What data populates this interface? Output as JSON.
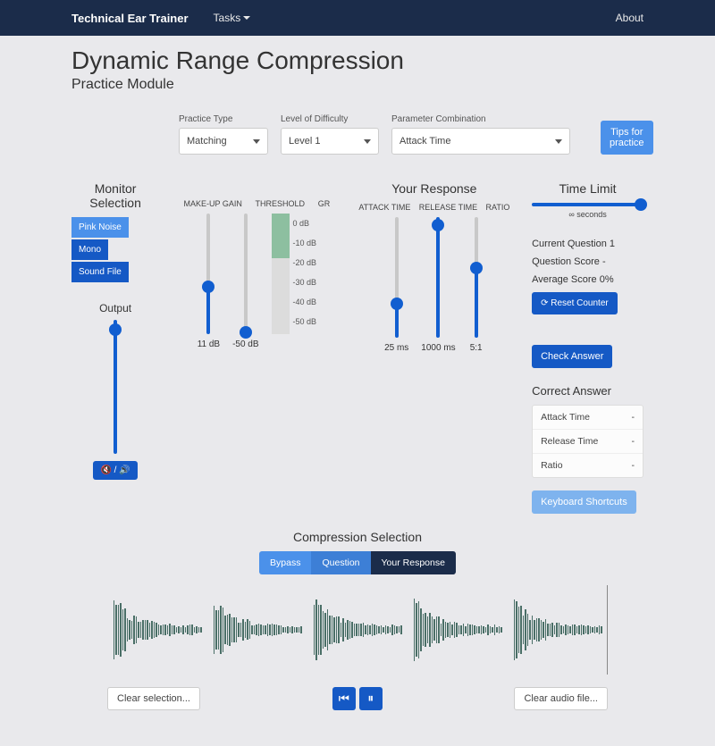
{
  "nav": {
    "brand": "Technical Ear Trainer",
    "tasks": "Tasks",
    "about": "About"
  },
  "title": "Dynamic Range Compression",
  "subtitle": "Practice Module",
  "controls": {
    "practiceType": {
      "label": "Practice Type",
      "value": "Matching"
    },
    "difficulty": {
      "label": "Level of Difficulty",
      "value": "Level 1"
    },
    "paramCombo": {
      "label": "Parameter Combination",
      "value": "Attack Time"
    },
    "tips": "Tips for practice"
  },
  "monitor": {
    "heading": "Monitor Selection",
    "pinkNoise": "Pink Noise",
    "mono": "Mono",
    "soundFile": "Sound File",
    "output": "Output",
    "mute": "🔇 / 🔊"
  },
  "meters": {
    "makeupGain": {
      "label": "MAKE-UP GAIN",
      "value": "11 dB"
    },
    "threshold": {
      "label": "THRESHOLD",
      "value": "-50 dB"
    },
    "gr": {
      "label": "GR",
      "ticks": [
        "0 dB",
        "-10 dB",
        "-20 dB",
        "-30 dB",
        "-40 dB",
        "-50 dB"
      ]
    }
  },
  "response": {
    "heading": "Your Response",
    "attack": {
      "label": "ATTACK TIME",
      "value": "25 ms"
    },
    "release": {
      "label": "RELEASE TIME",
      "value": "1000 ms"
    },
    "ratio": {
      "label": "RATIO",
      "value": "5:1"
    }
  },
  "side": {
    "timeLimit": {
      "heading": "Time Limit",
      "value": "∞ seconds"
    },
    "currentQ": "Current Question 1",
    "qScore": "Question Score -",
    "avgScore": "Average Score 0%",
    "reset": "⟳ Reset Counter",
    "check": "Check Answer",
    "correctHeading": "Correct Answer",
    "correct": {
      "attack": {
        "k": "Attack Time",
        "v": "-"
      },
      "release": {
        "k": "Release Time",
        "v": "-"
      },
      "ratio": {
        "k": "Ratio",
        "v": "-"
      }
    },
    "shortcuts": "Keyboard Shortcuts"
  },
  "comp": {
    "heading": "Compression Selection",
    "bypass": "Bypass",
    "question": "Question",
    "yourResponse": "Your Response",
    "clearSel": "Clear selection...",
    "clearAudio": "Clear audio file...",
    "prev": "⏮",
    "pause": "⏸"
  }
}
